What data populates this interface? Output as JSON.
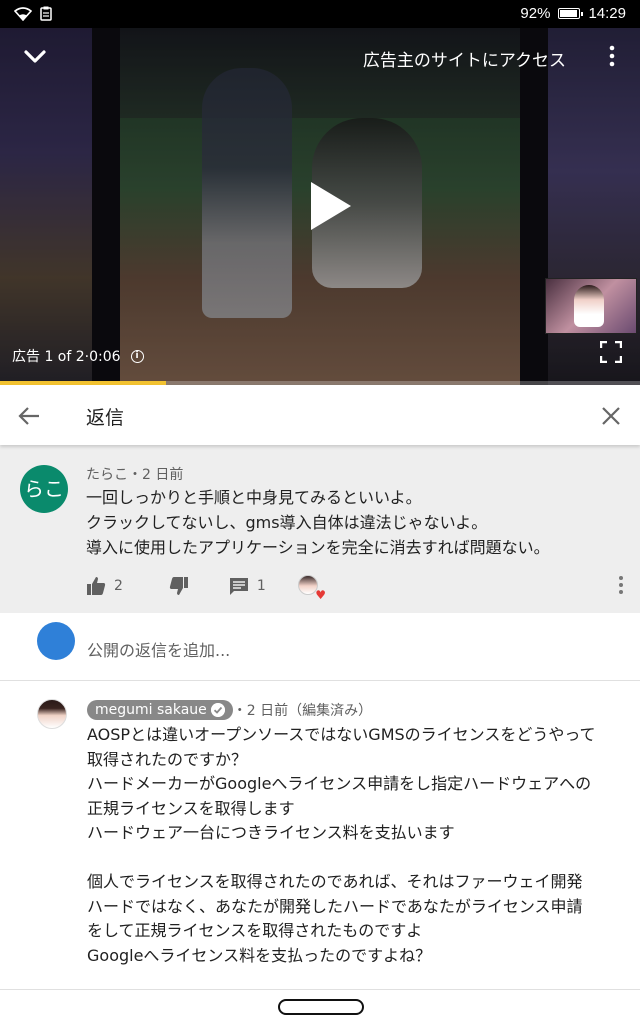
{
  "status_bar": {
    "battery": "92%",
    "time": "14:29",
    "battery_level": 0.92
  },
  "video": {
    "ad_link": "広告主のサイトにアクセス",
    "ad_info": "広告 1 of 2·0:06",
    "progress_fraction": 0.26
  },
  "replies_header": {
    "title": "返信"
  },
  "parent_comment": {
    "avatar_text": "らこ",
    "author_meta": "たらこ・2 日前",
    "lines": [
      "一回しっかりと手順と中身見てみるといいよ。",
      "クラックしてないし、gms導入自体は違法じゃないよ。",
      "導入に使用したアプリケーションを完全に消去すれば問題ない。"
    ],
    "likes": "2",
    "replies": "1"
  },
  "add_reply": {
    "placeholder": "公開の返信を追加..."
  },
  "reply_comment": {
    "author": "megumi sakaue",
    "meta": "・2 日前（編集済み）",
    "lines": [
      "AOSPとは違いオープンソースではないGMSのライセンスをどうやって",
      "取得されたのですか？",
      "ハードメーカーがGoogleへライセンス申請をし指定ハードウェアへの",
      "正規ライセンスを取得します",
      "ハードウェア一台につきライセンス料を支払います",
      "",
      "個人でライセンスを取得されたのであれば、それはファーウェイ開発",
      "ハードではなく、あなたが開発したハードであなたがライセンス申請",
      "をして正規ライセンスを取得されたものですよ",
      "Googleへライセンス料を支払ったのですよね？"
    ]
  },
  "colors": {
    "progress": "#f2c230",
    "avatar_rako": "#0a8a6c",
    "my_avatar": "#2f80d8",
    "heart": "#e53935"
  }
}
